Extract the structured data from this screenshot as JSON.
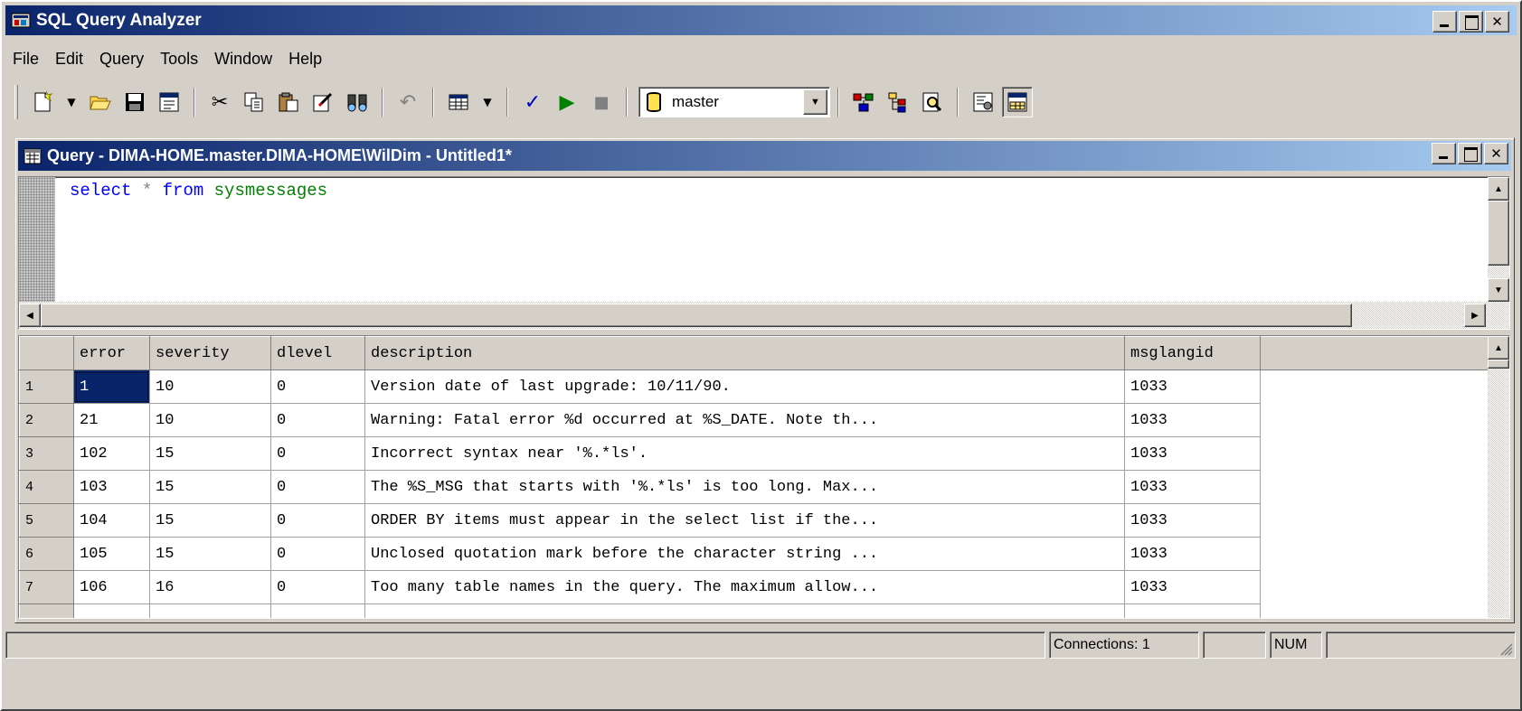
{
  "app": {
    "title": "SQL Query Analyzer",
    "caption_buttons": [
      "minimize",
      "maximize",
      "close"
    ]
  },
  "menu": [
    "File",
    "Edit",
    "Query",
    "Tools",
    "Window",
    "Help"
  ],
  "toolbar": {
    "icons": [
      "new-query-icon",
      "dropdown-arrow-icon",
      "open-folder-icon",
      "save-icon",
      "load-script-icon",
      "cut-icon",
      "copy-icon",
      "paste-icon",
      "clear-window-icon",
      "find-icon",
      "undo-icon",
      "results-mode-icon",
      "dropdown-arrow-icon",
      "parse-check-icon",
      "execute-play-icon",
      "cancel-stop-icon",
      "display-plan-icon",
      "object-browser-icon",
      "search-object-icon",
      "properties-icon",
      "show-results-pane-icon"
    ],
    "database": "master"
  },
  "query_window": {
    "title": "Query - DIMA-HOME.master.DIMA-HOME\\WilDim - Untitled1*",
    "sql": {
      "kw1": "select",
      "star": "*",
      "kw2": "from",
      "obj": "sysmessages"
    }
  },
  "grid": {
    "columns": [
      "error",
      "severity",
      "dlevel",
      "description",
      "msglangid"
    ],
    "rows": [
      [
        "1",
        "1",
        "10",
        "0",
        "Version date of last upgrade: 10/11/90.",
        "1033"
      ],
      [
        "2",
        "21",
        "10",
        "0",
        "Warning: Fatal error %d occurred at %S_DATE. Note th...",
        "1033"
      ],
      [
        "3",
        "102",
        "15",
        "0",
        "Incorrect syntax near '%.*ls'.",
        "1033"
      ],
      [
        "4",
        "103",
        "15",
        "0",
        "The %S_MSG that starts with '%.*ls' is too long. Max...",
        "1033"
      ],
      [
        "5",
        "104",
        "15",
        "0",
        "ORDER BY items must appear in the select list if the...",
        "1033"
      ],
      [
        "6",
        "105",
        "15",
        "0",
        "Unclosed quotation mark before the character string ...",
        "1033"
      ],
      [
        "7",
        "106",
        "16",
        "0",
        "Too many table names in the query. The maximum allow...",
        "1033"
      ]
    ]
  },
  "status": {
    "connections": "Connections: 1",
    "num": "NUM"
  },
  "colors": {
    "titlebar_start": "#0a246a",
    "titlebar_end": "#a6caf0",
    "face": "#d4d0c8",
    "keyword": "#0000ff",
    "object": "#008000"
  }
}
